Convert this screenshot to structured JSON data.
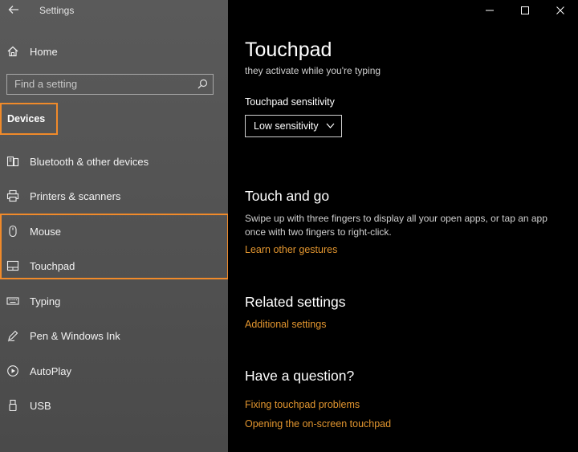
{
  "window": {
    "title": "Settings"
  },
  "colors": {
    "accent": "#f08a2a",
    "link": "#e3962f",
    "sidebar_bg": "#545454",
    "content_bg": "#000000"
  },
  "sidebar": {
    "home_label": "Home",
    "search_placeholder": "Find a setting",
    "section_title": "Devices",
    "items": [
      {
        "label": "Bluetooth & other devices",
        "icon": "bluetooth-devices-icon"
      },
      {
        "label": "Printers & scanners",
        "icon": "printer-icon"
      },
      {
        "label": "Mouse",
        "icon": "mouse-icon"
      },
      {
        "label": "Touchpad",
        "icon": "touchpad-icon"
      },
      {
        "label": "Typing",
        "icon": "keyboard-icon"
      },
      {
        "label": "Pen & Windows Ink",
        "icon": "pen-icon"
      },
      {
        "label": "AutoPlay",
        "icon": "autoplay-icon"
      },
      {
        "label": "USB",
        "icon": "usb-icon"
      }
    ]
  },
  "main": {
    "title": "Touchpad",
    "subtext": "they activate while you're typing",
    "sensitivity_label": "Touchpad sensitivity",
    "sensitivity_value": "Low sensitivity",
    "touch_and_go": {
      "heading": "Touch and go",
      "description": "Swipe up with three fingers to display all your open apps, or tap an app once with two fingers to right-click.",
      "link": "Learn other gestures"
    },
    "related": {
      "heading": "Related settings",
      "link": "Additional settings"
    },
    "question": {
      "heading": "Have a question?",
      "links": [
        "Fixing touchpad problems",
        "Opening the on-screen touchpad"
      ]
    }
  }
}
